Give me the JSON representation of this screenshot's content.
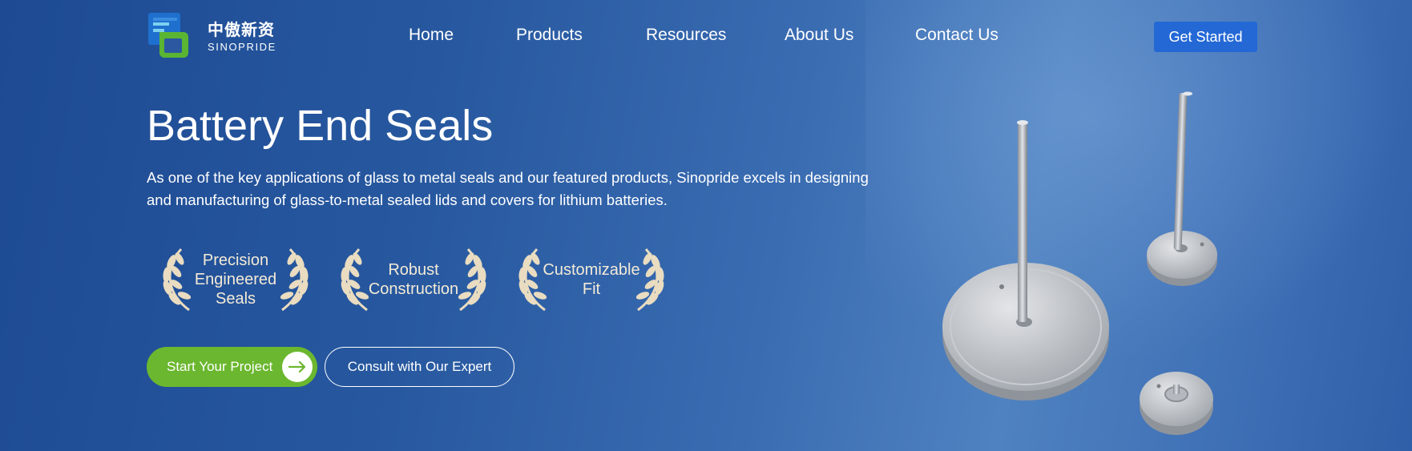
{
  "brand": {
    "name_cn": "中傲新资",
    "name_en": "SINOPRIDE"
  },
  "nav": {
    "items": [
      {
        "label": "Home"
      },
      {
        "label": "Products"
      },
      {
        "label": "Resources"
      },
      {
        "label": "About Us"
      },
      {
        "label": "Contact Us"
      }
    ],
    "cta_label": "Get Started"
  },
  "hero": {
    "title": "Battery End Seals",
    "description": "As one of the key applications of glass to metal seals and our featured products, Sinopride excels in designing and manufacturing of glass-to-metal sealed lids and covers for lithium batteries.",
    "badges": [
      {
        "label": "Precision\nEngineered\nSeals"
      },
      {
        "label": "Robust\nConstruction"
      },
      {
        "label": "Customizable\nFit"
      }
    ],
    "primary_button": "Start Your Project",
    "secondary_button": "Consult with Our Expert"
  },
  "colors": {
    "cta_blue": "#2468d6",
    "primary_green": "#6bb72f",
    "badge_laurel": "#e9dcc0"
  },
  "icons": {
    "logo": "sinopride-logo-icon",
    "laurel": "laurel-wreath-icon",
    "arrow": "arrow-right-icon"
  }
}
